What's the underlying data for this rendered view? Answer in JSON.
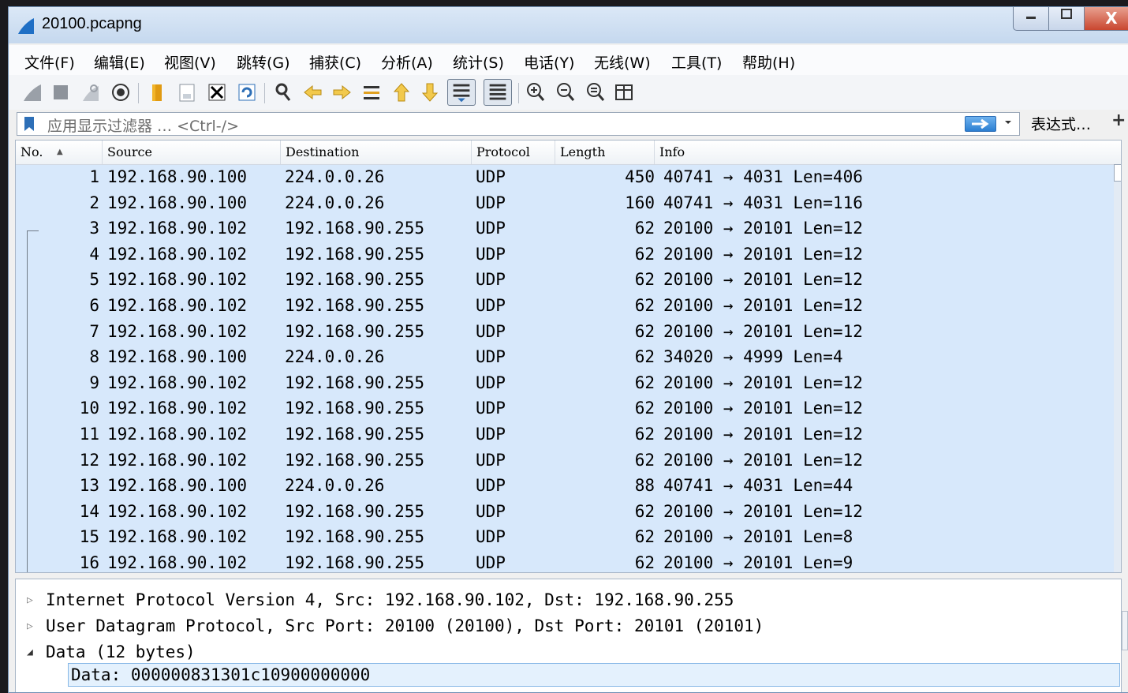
{
  "window": {
    "title": "20100.pcapng",
    "buttons": {
      "minimize": "—",
      "maximize": "□",
      "close": "X"
    }
  },
  "menu": [
    "文件(F)",
    "编辑(E)",
    "视图(V)",
    "跳转(G)",
    "捕获(C)",
    "分析(A)",
    "统计(S)",
    "电话(Y)",
    "无线(W)",
    "工具(T)",
    "帮助(H)"
  ],
  "toolbar": {
    "icons": [
      "shark-fin-start-icon",
      "stop-square-icon",
      "restart-fin-icon",
      "capture-options-icon",
      "open-folder-icon",
      "save-file-icon",
      "close-file-icon",
      "reload-icon",
      "find-packet-icon",
      "go-back-icon",
      "go-forward-icon",
      "go-to-packet-icon",
      "first-packet-icon",
      "last-packet-icon",
      "auto-scroll-icon",
      "colorize-icon",
      "zoom-in-icon",
      "zoom-out-icon",
      "normal-size-icon",
      "resize-columns-icon"
    ]
  },
  "filter": {
    "placeholder": "应用显示过滤器 … <Ctrl-/>",
    "expression_label": "表达式…",
    "add_label": "+"
  },
  "packet_list": {
    "columns": [
      "No.",
      "Source",
      "Destination",
      "Protocol",
      "Length",
      "Info"
    ],
    "rows": [
      {
        "no": "1",
        "src": "192.168.90.100",
        "dst": "224.0.0.26",
        "proto": "UDP",
        "len": "450",
        "info": "40741 → 4031  Len=406"
      },
      {
        "no": "2",
        "src": "192.168.90.100",
        "dst": "224.0.0.26",
        "proto": "UDP",
        "len": "160",
        "info": "40741 → 4031  Len=116"
      },
      {
        "no": "3",
        "src": "192.168.90.102",
        "dst": "192.168.90.255",
        "proto": "UDP",
        "len": "62",
        "info": "20100 → 20101  Len=12"
      },
      {
        "no": "4",
        "src": "192.168.90.102",
        "dst": "192.168.90.255",
        "proto": "UDP",
        "len": "62",
        "info": "20100 → 20101  Len=12"
      },
      {
        "no": "5",
        "src": "192.168.90.102",
        "dst": "192.168.90.255",
        "proto": "UDP",
        "len": "62",
        "info": "20100 → 20101  Len=12"
      },
      {
        "no": "6",
        "src": "192.168.90.102",
        "dst": "192.168.90.255",
        "proto": "UDP",
        "len": "62",
        "info": "20100 → 20101  Len=12"
      },
      {
        "no": "7",
        "src": "192.168.90.102",
        "dst": "192.168.90.255",
        "proto": "UDP",
        "len": "62",
        "info": "20100 → 20101  Len=12"
      },
      {
        "no": "8",
        "src": "192.168.90.100",
        "dst": "224.0.0.26",
        "proto": "UDP",
        "len": "62",
        "info": "34020 → 4999  Len=4"
      },
      {
        "no": "9",
        "src": "192.168.90.102",
        "dst": "192.168.90.255",
        "proto": "UDP",
        "len": "62",
        "info": "20100 → 20101  Len=12"
      },
      {
        "no": "10",
        "src": "192.168.90.102",
        "dst": "192.168.90.255",
        "proto": "UDP",
        "len": "62",
        "info": "20100 → 20101  Len=12"
      },
      {
        "no": "11",
        "src": "192.168.90.102",
        "dst": "192.168.90.255",
        "proto": "UDP",
        "len": "62",
        "info": "20100 → 20101  Len=12"
      },
      {
        "no": "12",
        "src": "192.168.90.102",
        "dst": "192.168.90.255",
        "proto": "UDP",
        "len": "62",
        "info": "20100 → 20101  Len=12"
      },
      {
        "no": "13",
        "src": "192.168.90.100",
        "dst": "224.0.0.26",
        "proto": "UDP",
        "len": "88",
        "info": "40741 → 4031  Len=44"
      },
      {
        "no": "14",
        "src": "192.168.90.102",
        "dst": "192.168.90.255",
        "proto": "UDP",
        "len": "62",
        "info": "20100 → 20101  Len=12"
      },
      {
        "no": "15",
        "src": "192.168.90.102",
        "dst": "192.168.90.255",
        "proto": "UDP",
        "len": "62",
        "info": "20100 → 20101  Len=8"
      },
      {
        "no": "16",
        "src": "192.168.90.102",
        "dst": "192.168.90.255",
        "proto": "UDP",
        "len": "62",
        "info": "20100 → 20101  Len=9"
      }
    ]
  },
  "details": {
    "lines": [
      "Internet Protocol Version 4, Src: 192.168.90.102, Dst: 192.168.90.255",
      "User Datagram Protocol, Src Port: 20100 (20100), Dst Port: 20101 (20101)",
      "Data (12 bytes)"
    ],
    "selected": "Data: 000000831301c10900000000"
  },
  "colors": {
    "row_bg": "#d7e8fb",
    "titlebar": "#c5d8ee",
    "close_button": "#c9462f"
  }
}
